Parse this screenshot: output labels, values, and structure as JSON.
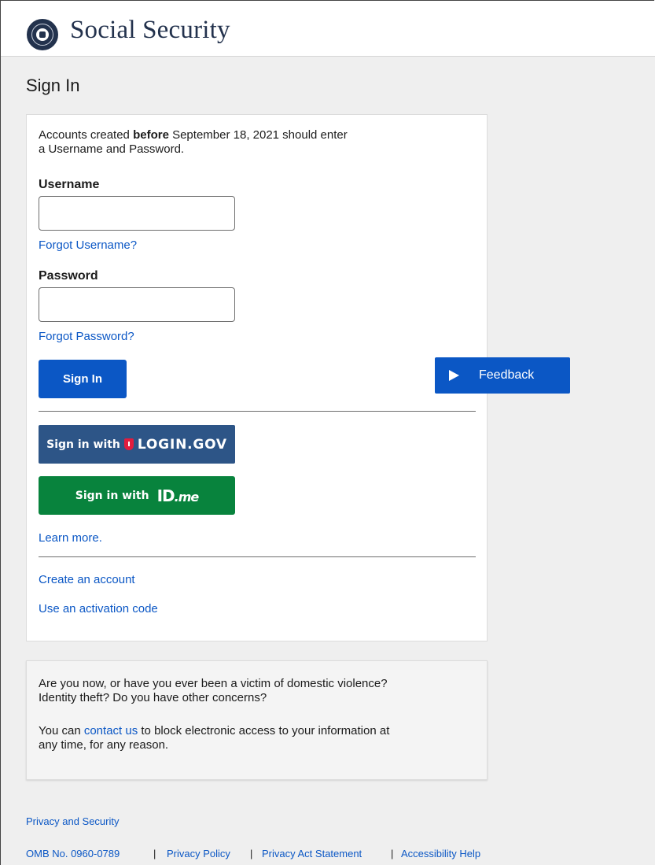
{
  "header": {
    "brand": "Social Security",
    "seal_icon": "ssa-seal-icon"
  },
  "page_title": "Sign In",
  "signin_card": {
    "intro_prefix": "Accounts created ",
    "intro_bold": "before",
    "intro_line1_rest": " September 18, 2021 should enter",
    "intro_line2": "a Username and Password.",
    "username_label": "Username",
    "username_value": "",
    "forgot_username": "Forgot Username?",
    "password_label": "Password",
    "password_value": "",
    "forgot_password": "Forgot Password?",
    "signin_button": "Sign In",
    "logingov_prefix": "Sign in with",
    "logingov_brand": "LOGIN.GOV",
    "idme_prefix": "Sign in with",
    "idme_brand_id": "ID",
    "idme_brand_me": ".me",
    "learn_more": "Learn more.",
    "create_account": "Create an account",
    "activation_code": "Use an activation code"
  },
  "feedback": {
    "label": "Feedback",
    "icon": "play-icon"
  },
  "notice": {
    "line1": "Are you now, or have you ever been a victim of domestic violence?",
    "line2": "Identity theft? Do you have other concerns?",
    "p2_prefix": "You can ",
    "p2_link": "contact us",
    "p2_suffix": " to block electronic access to your information at",
    "p2_line2": "any time, for any reason."
  },
  "footer": {
    "privacy_security": "Privacy and Security",
    "omb": "OMB No. 0960-0789",
    "privacy_policy": "Privacy Policy",
    "privacy_act": "Privacy Act Statement",
    "accessibility": "Accessibility Help",
    "separator": "|"
  },
  "colors": {
    "link": "#0b57c5",
    "primary_button": "#0b57c5",
    "logingov_button": "#2d5587",
    "idme_button": "#08833d",
    "brand_navy": "#23324d",
    "page_bg": "#efefef"
  }
}
